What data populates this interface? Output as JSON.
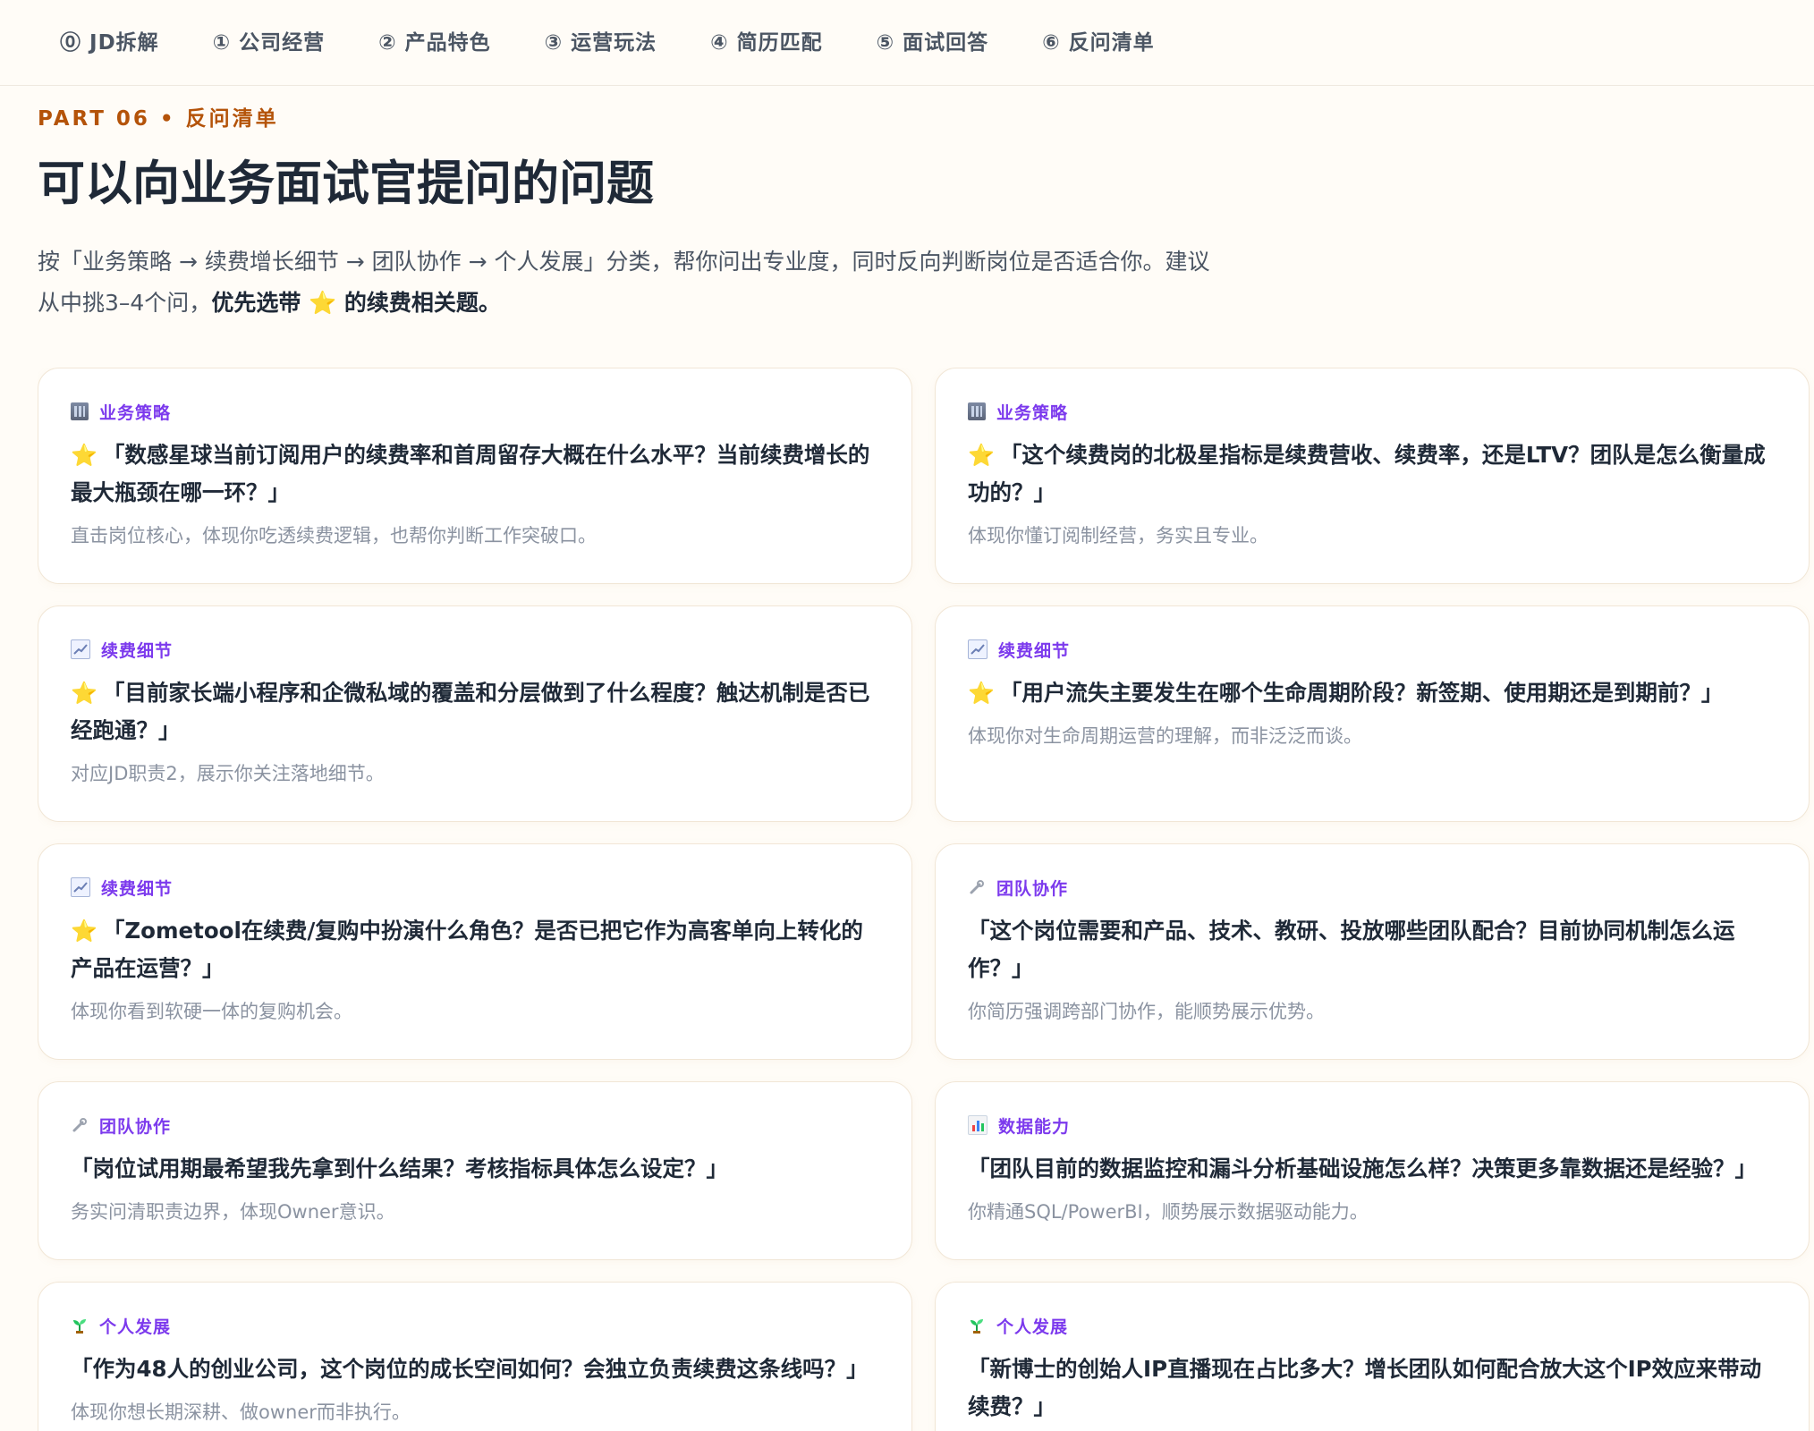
{
  "nav": {
    "items": [
      "⓪ JD拆解",
      "① 公司经营",
      "② 产品特色",
      "③ 运营玩法",
      "④ 简历匹配",
      "⑤ 面试回答",
      "⑥ 反问清单"
    ]
  },
  "header": {
    "eyebrow": "PART 06 • 反问清单",
    "title": "可以向业务面试官提问的问题",
    "intro_line1": "按「业务策略 → 续费增长细节 → 团队协作 → 个人发展」分类，帮你问出专业度，同时反向判断岗位是否适合你。建议",
    "intro_line2_a": "从中挑3–4个问，",
    "intro_line2_b": "优先选带 ⭐ 的续费相关题。"
  },
  "colors": {
    "accent_eyebrow": "#b45309",
    "category": "#7c3aed",
    "star": "#f5b301"
  },
  "cards": [
    {
      "category": "业务策略",
      "icon": "building-icon",
      "starred": "⭐",
      "question": "「数感星球当前订阅用户的续费率和首周留存大概在什么水平？当前续费增长的最大瓶颈在哪一环？」",
      "note": "直击岗位核心，体现你吃透续费逻辑，也帮你判断工作突破口。"
    },
    {
      "category": "业务策略",
      "icon": "building-icon",
      "starred": "⭐",
      "question": "「这个续费岗的北极星指标是续费营收、续费率，还是LTV？团队是怎么衡量成功的？」",
      "note": "体现你懂订阅制经营，务实且专业。"
    },
    {
      "category": "续费细节",
      "icon": "chart-icon",
      "starred": "⭐",
      "question": "「目前家长端小程序和企微私域的覆盖和分层做到了什么程度？触达机制是否已经跑通？」",
      "note": "对应JD职责2，展示你关注落地细节。"
    },
    {
      "category": "续费细节",
      "icon": "chart-icon",
      "starred": "⭐",
      "question": "「用户流失主要发生在哪个生命周期阶段？新签期、使用期还是到期前？」",
      "note": "体现你对生命周期运营的理解，而非泛泛而谈。"
    },
    {
      "category": "续费细节",
      "icon": "chart-icon",
      "starred": "⭐",
      "question": "「Zometool在续费/复购中扮演什么角色？是否已把它作为高客单向上转化的产品在运营？」",
      "note": "体现你看到软硬一体的复购机会。"
    },
    {
      "category": "团队协作",
      "icon": "wrench-icon",
      "starred": "",
      "question": "「这个岗位需要和产品、技术、教研、投放哪些团队配合？目前协同机制怎么运作？」",
      "note": "你简历强调跨部门协作，能顺势展示优势。"
    },
    {
      "category": "团队协作",
      "icon": "wrench-icon",
      "starred": "",
      "question": "「岗位试用期最希望我先拿到什么结果？考核指标具体怎么设定？」",
      "note": "务实问清职责边界，体现Owner意识。"
    },
    {
      "category": "数据能力",
      "icon": "bar-chart-icon",
      "starred": "",
      "question": "「团队目前的数据监控和漏斗分析基础设施怎么样？决策更多靠数据还是经验？」",
      "note": "你精通SQL/PowerBI，顺势展示数据驱动能力。"
    },
    {
      "category": "个人发展",
      "icon": "seedling-icon",
      "starred": "",
      "question": "「作为48人的创业公司，这个岗位的成长空间如何？会独立负责续费这条线吗？」",
      "note": "体现你想长期深耕、做owner而非执行。"
    },
    {
      "category": "个人发展",
      "icon": "seedling-icon",
      "starred": "",
      "question": "「新博士的创始人IP直播现在占比多大？增长团队如何配合放大这个IP效应来带动续费？」",
      "note": ""
    }
  ]
}
